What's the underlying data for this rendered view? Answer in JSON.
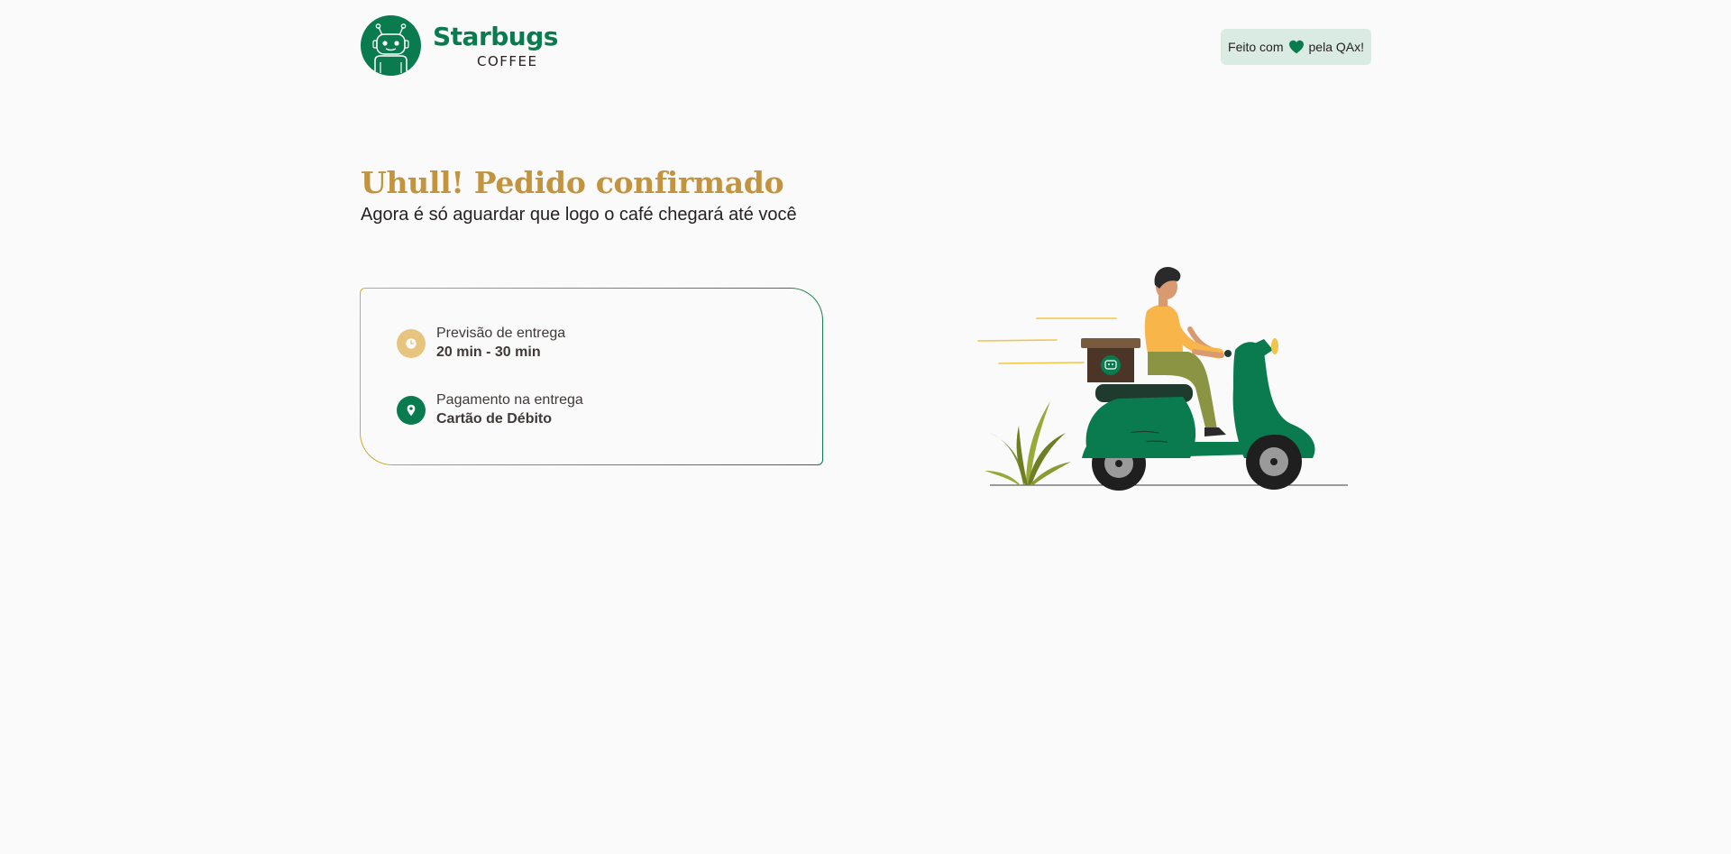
{
  "brand": {
    "name": "Starbugs",
    "subname": "COFFEE",
    "primary_color": "#0a7b4f",
    "accent_color": "#c29440"
  },
  "badge": {
    "prefix": "Feito com",
    "suffix": "pela QAx!",
    "icon": "heart-icon"
  },
  "confirmation": {
    "title": "Uhull! Pedido confirmado",
    "subtitle": "Agora é só aguardar que logo o café chegará até você"
  },
  "delivery": {
    "estimate_label": "Previsão de entrega",
    "estimate_value": "20 min - 30 min",
    "estimate_icon": "clock-icon",
    "payment_label": "Pagamento na entrega",
    "payment_value": "Cartão de Débito",
    "payment_icon": "map-pin-icon"
  },
  "illustration": {
    "subject": "delivery-scooter-illustration"
  }
}
